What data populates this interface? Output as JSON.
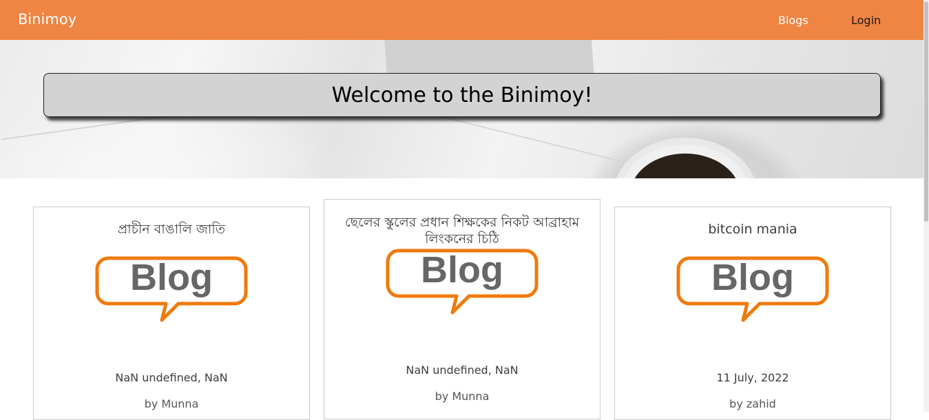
{
  "navbar": {
    "brand": "Binimoy",
    "links": [
      {
        "label": "Blogs"
      },
      {
        "label": "Login"
      }
    ],
    "color": "#ef8443"
  },
  "hero": {
    "heading": "Welcome to the Binimoy!"
  },
  "posts": [
    {
      "title": "প্রাচীন বাঙালি জাতি",
      "logo_text": "Blog",
      "date": "NaN undefined, NaN",
      "author": "by Munna"
    },
    {
      "title": "ছেলের স্কুলের প্রধান শিক্ষকের নিকট আব্রাহাম লিংকনের চিঠি",
      "logo_text": "Blog",
      "date": "NaN undefined, NaN",
      "author": "by Munna"
    },
    {
      "title": "bitcoin mania",
      "logo_text": "Blog",
      "date": "11 July, 2022",
      "author": "by zahid"
    }
  ],
  "logo_colors": {
    "bubble_stroke": "#f07a0c",
    "text": "#666666"
  }
}
